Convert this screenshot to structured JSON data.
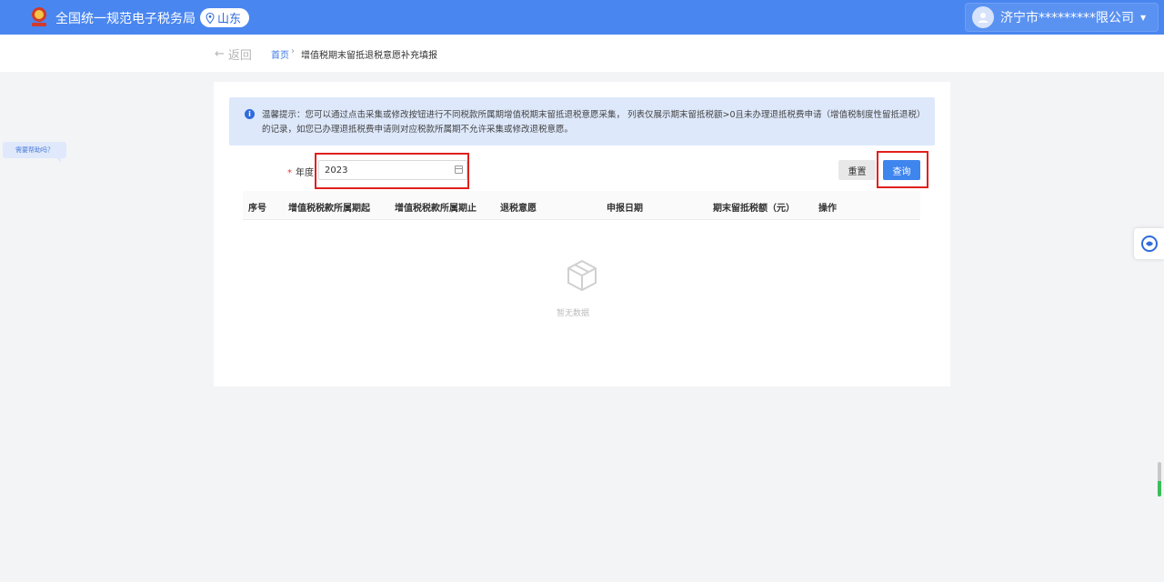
{
  "header": {
    "site_title": "全国统一规范电子税务局",
    "region": "山东",
    "company": "济宁市*********限公司",
    "emblem_icon": "tax-emblem-icon",
    "location_icon": "location-pin-icon",
    "user_icon": "user-avatar-icon"
  },
  "subheader": {
    "back_label": "返回",
    "breadcrumb_home": "首页",
    "breadcrumb_sep": "›",
    "breadcrumb_current": "增值税期末留抵退税意愿补充填报"
  },
  "help": {
    "label": "需要帮助吗？"
  },
  "notice": {
    "text": "温馨提示：您可以通过点击采集或修改按钮进行不同税款所属期增值税期末留抵退税意愿采集， 列表仅展示期末留抵税额>0且未办理退抵税费申请（增值税制度性留抵退税）的记录，如您已办理退抵税费申请则对应税款所属期不允许采集或修改退税意愿。"
  },
  "form": {
    "year_label": "年度",
    "required_mark": "*",
    "year_value": "2023",
    "reset_label": "重置",
    "query_label": "查询"
  },
  "table": {
    "columns": [
      "序号",
      "增值税税款所属期起",
      "增值税税款所属期止",
      "退税意愿",
      "申报日期",
      "期末留抵税额（元）",
      "操作"
    ],
    "empty_text": "暂无数据"
  },
  "colors": {
    "header_bg": "#4a86f0",
    "accent": "#3f85ee",
    "highlight": "#e0201d"
  }
}
